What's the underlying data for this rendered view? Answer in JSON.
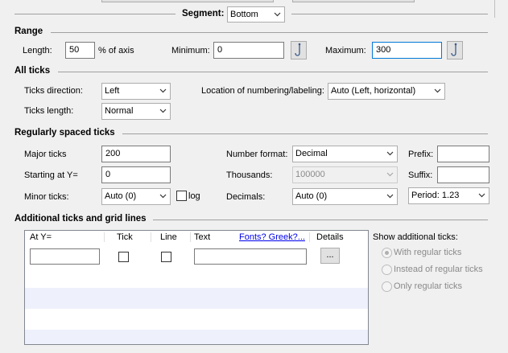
{
  "segment": {
    "label": "Segment:",
    "value": "Bottom"
  },
  "range": {
    "title": "Range",
    "length_label": "Length:",
    "length_value": "50",
    "length_unit": "% of axis",
    "minimum_label": "Minimum:",
    "minimum_value": "0",
    "maximum_label": "Maximum:",
    "maximum_value": "300"
  },
  "all_ticks": {
    "title": "All ticks",
    "direction_label": "Ticks direction:",
    "direction_value": "Left",
    "numbering_label": "Location of numbering/labeling:",
    "numbering_value": "Auto (Left, horizontal)",
    "length_label": "Ticks length:",
    "length_value": "Normal"
  },
  "regular": {
    "title": "Regularly spaced ticks",
    "major_label": "Major ticks",
    "major_value": "200",
    "start_label": "Starting at Y=",
    "start_value": "0",
    "minor_label": "Minor ticks:",
    "minor_value": "Auto (0)",
    "log_label": "log",
    "format_label": "Number format:",
    "format_value": "Decimal",
    "thousands_label": "Thousands:",
    "thousands_value": "100000",
    "decimals_label": "Decimals:",
    "decimals_value": "Auto (0)",
    "prefix_label": "Prefix:",
    "prefix_value": "",
    "suffix_label": "Suffix:",
    "suffix_value": "",
    "period_value": "Period: 1.23"
  },
  "additional": {
    "title": "Additional ticks and grid lines",
    "columns": {
      "at": "At Y=",
      "tick": "Tick",
      "line": "Line",
      "text": "Text",
      "fonts_link": "Fonts? Greek?...",
      "details": "Details"
    },
    "details_button": "...",
    "show_label": "Show additional ticks:",
    "options": [
      "With regular ticks",
      "Instead of regular ticks",
      "Only regular ticks"
    ],
    "selected_option": 0
  },
  "colors": {
    "focus": "#0078d7",
    "link": "#0000ee",
    "alt_row": "#eef1fb"
  }
}
